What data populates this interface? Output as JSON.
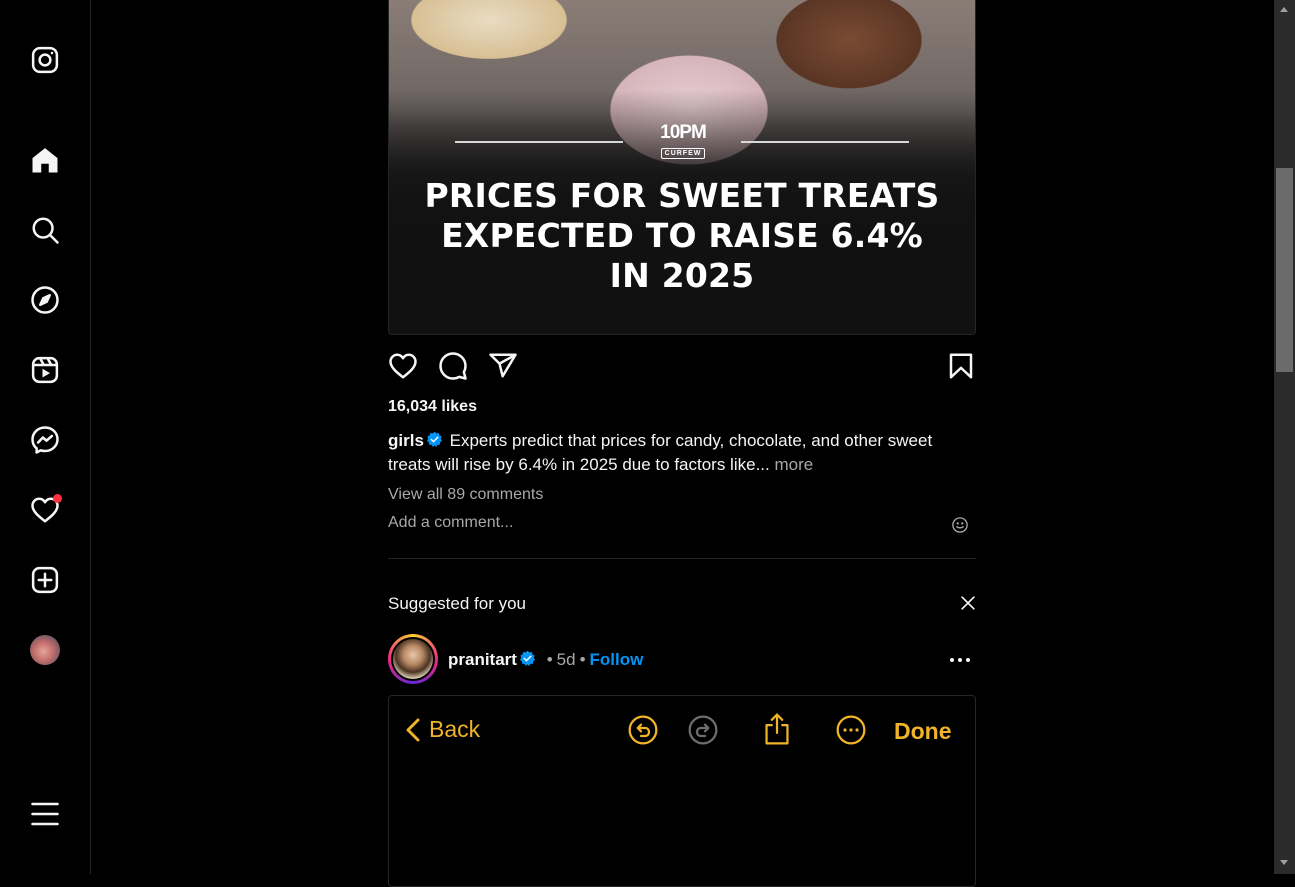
{
  "sidebar": {
    "items": [
      {
        "icon": "instagram-logo-icon"
      },
      {
        "icon": "home-icon"
      },
      {
        "icon": "search-icon"
      },
      {
        "icon": "explore-compass-icon"
      },
      {
        "icon": "reels-icon"
      },
      {
        "icon": "messenger-icon"
      },
      {
        "icon": "notifications-heart-icon",
        "has_badge": true
      },
      {
        "icon": "create-plus-icon"
      },
      {
        "icon": "profile-avatar"
      },
      {
        "icon": "menu-hamburger-icon"
      }
    ]
  },
  "post": {
    "image": {
      "brand_top": "10PM",
      "brand_bottom": "CURFEW",
      "headline_lines": [
        "PRICES FOR SWEET TREATS",
        "EXPECTED TO RAISE 6.4%",
        "IN 2025"
      ]
    },
    "likes": "16,034 likes",
    "caption": {
      "username": "girls",
      "text": "Experts predict that prices for candy, chocolate, and other sweet treats will rise by 6.4% in 2025 due to factors like...",
      "more_label": "more"
    },
    "view_comments": "View all 89 comments",
    "add_comment_placeholder": "Add a comment..."
  },
  "suggested": {
    "title": "Suggested for you",
    "post": {
      "username": "pranitart",
      "separator": "•",
      "time": "5d",
      "follow_label": "Follow",
      "preview": {
        "back_label": "Back",
        "done_label": "Done"
      }
    }
  },
  "colors": {
    "background": "#000000",
    "text": "#f5f5f5",
    "secondary_text": "#a8a8a8",
    "link_blue": "#0095f6",
    "notification_red": "#ff3040",
    "preview_accent": "#f0b429"
  }
}
